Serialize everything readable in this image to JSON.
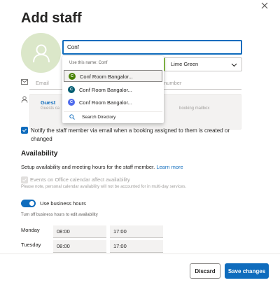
{
  "panel": {
    "title": "Add staff",
    "close_icon": "close-icon"
  },
  "name_input": {
    "value": "Conf"
  },
  "color": {
    "value": "Lime Green",
    "swatch": "#8bc34a"
  },
  "email": {
    "placeholder": "Email"
  },
  "phone": {
    "placeholder": "number"
  },
  "role": {
    "label": "Guest",
    "description": "Guests ca",
    "mailbox_text": "booking mailbox"
  },
  "notify": {
    "checked": true,
    "label": "Notify the staff member via email when a booking assigned to them is created or changed"
  },
  "availability": {
    "title": "Availability",
    "setup_text": "Setup availability and meeting hours for the staff member.",
    "learn_more": "Learn more",
    "events_label": "Events on Office calendar affect availability",
    "note": "Please note, personal calendar availability will not be accounted for in multi-day services.",
    "business_hours_label": "Use business hours",
    "business_hours_on": true,
    "hint": "Turn off business hours to edit availability",
    "days": [
      {
        "day": "Monday",
        "start": "08:00",
        "end": "17:00"
      },
      {
        "day": "Tuesday",
        "start": "08:00",
        "end": "17:00"
      }
    ]
  },
  "footer": {
    "discard": "Discard",
    "save": "Save changes"
  },
  "dropdown": {
    "header": "Use this name: Conf",
    "items": [
      {
        "initial": "C",
        "label": "Conf Room Bangalor...",
        "color": "#498205"
      },
      {
        "initial": "C",
        "label": "Conf Room Bangalor...",
        "color": "#005b70"
      },
      {
        "initial": "C",
        "label": "Conf Room Bangalor...",
        "color": "#4f6bed"
      }
    ],
    "search": "Search Directory"
  },
  "colors": {
    "accent": "#0f6cbd",
    "avatar_bg": "#dbe7c9",
    "avatar_fg": "#7ea25d"
  }
}
